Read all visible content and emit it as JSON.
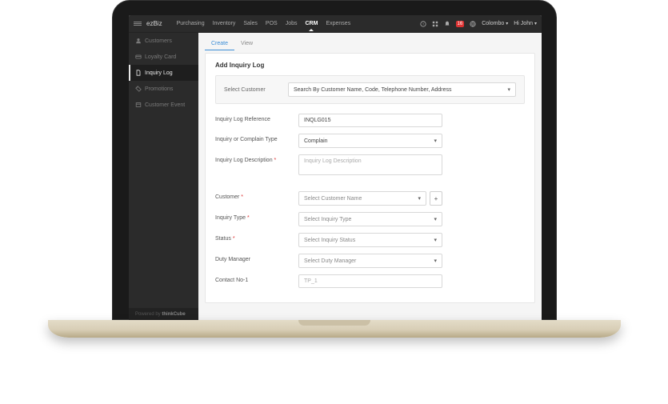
{
  "brand": "ezBiz",
  "top_nav": {
    "items": [
      "Purchasing",
      "Inventory",
      "Sales",
      "POS",
      "Jobs",
      "CRM",
      "Expenses"
    ],
    "active_index": 5
  },
  "topbar_right": {
    "notif_badge": "16",
    "location": "Colombo",
    "user": "Hi John"
  },
  "sidebar": {
    "items": [
      {
        "label": "Customers",
        "icon": "user"
      },
      {
        "label": "Loyalty Card",
        "icon": "card"
      },
      {
        "label": "Inquiry Log",
        "icon": "file"
      },
      {
        "label": "Promotions",
        "icon": "tag"
      },
      {
        "label": "Customer Event",
        "icon": "calendar"
      }
    ],
    "active_index": 2
  },
  "footer": {
    "prefix": "Powered by ",
    "name": "thinkCube"
  },
  "tabs": {
    "items": [
      "Create",
      "View"
    ],
    "active_index": 0
  },
  "panel": {
    "title": "Add Inquiry Log",
    "select_customer_label": "Select Customer",
    "select_customer_placeholder": "Search By Customer Name, Code, Telephone Number, Address",
    "fields": {
      "ref": {
        "label": "Inquiry Log Reference",
        "value": "INQLG015"
      },
      "complain_type": {
        "label": "Inquiry or Complain Type",
        "value": "Complain"
      },
      "description": {
        "label": "Inquiry Log Description",
        "placeholder": "Inquiry Log Description",
        "required": true
      },
      "customer": {
        "label": "Customer",
        "placeholder": "Select Customer Name",
        "required": true
      },
      "inquiry_type": {
        "label": "Inquiry Type",
        "placeholder": "Select Inquiry Type",
        "required": true
      },
      "status": {
        "label": "Status",
        "placeholder": "Select Inquiry Status",
        "required": true
      },
      "duty_manager": {
        "label": "Duty Manager",
        "placeholder": "Select Duty Manager"
      },
      "contact1": {
        "label": "Contact No-1",
        "placeholder": "TP_1"
      }
    }
  }
}
